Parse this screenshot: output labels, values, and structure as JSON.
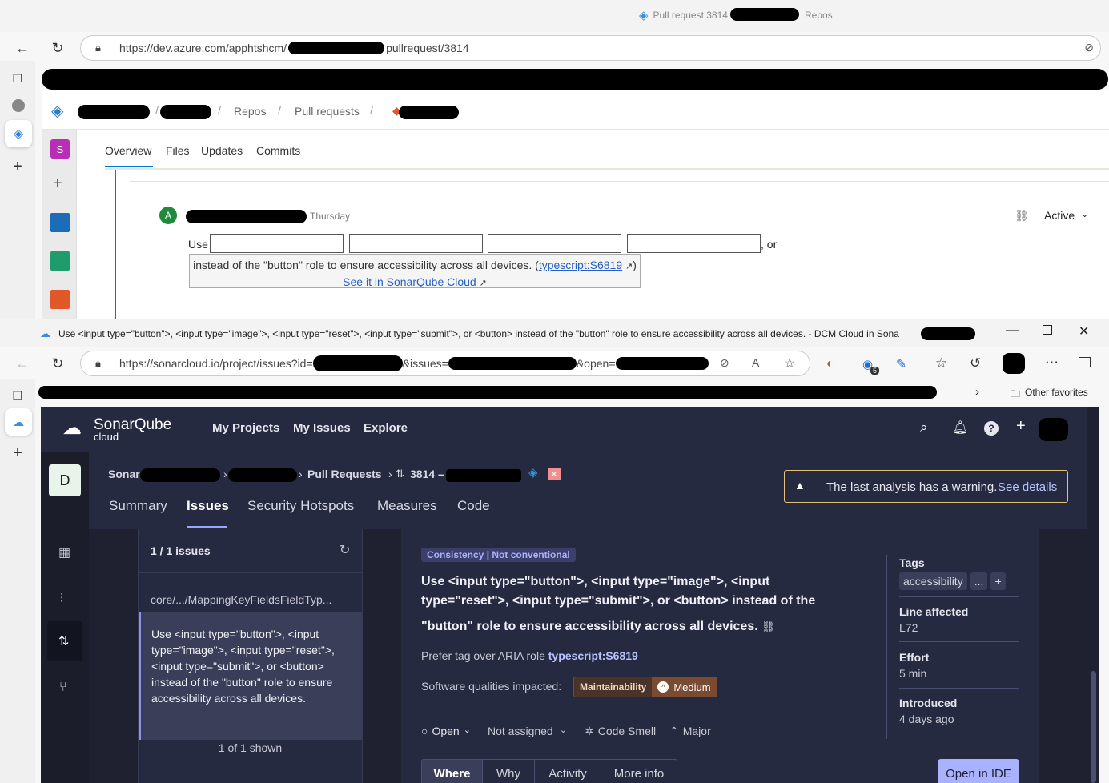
{
  "top_window": {
    "tab_title": "Pull request 3814",
    "tab_suffix": "Repos",
    "url_prefix": "https://dev.azure.com/apphtshcm/",
    "url_suffix": "pullrequest/3814",
    "breadcrumb": {
      "repos": "Repos",
      "pull_requests": "Pull requests",
      "sep": "/"
    },
    "pr_tabs": [
      "Overview",
      "Files",
      "Updates",
      "Commits"
    ],
    "org_letter": "S",
    "comment": {
      "avatar_letter": "A",
      "when": "Thursday",
      "status": "Active",
      "text_use": "Use",
      "text_or": ", or",
      "tooltip_line1": "instead of the \"button\" role to ensure accessibility across all devices. (",
      "tooltip_rule": "typescript:S6819",
      "tooltip_close": ")",
      "tooltip_line2": "See it in SonarQube Cloud"
    }
  },
  "bottom_window": {
    "title": "Use <input type=\"button\">, <input type=\"image\">, <input type=\"reset\">, <input type=\"submit\">, or <button> instead of the \"button\" role to ensure accessibility across all devices. - DCM Cloud in Sona",
    "url_prefix": "https://sonarcloud.io/project/issues?id=",
    "url_mid1": "&issues=",
    "url_mid2": "&open=",
    "other_favorites": "Other favorites",
    "ext_badge": "5"
  },
  "sonar": {
    "logo_main": "SonarQube",
    "logo_sub": "cloud",
    "nav": [
      "My Projects",
      "My Issues",
      "Explore"
    ],
    "project_letter": "D",
    "breadcrumb": {
      "org": "Sonar",
      "pull_requests": "Pull Requests",
      "pr": "3814 –"
    },
    "tabs": [
      "Summary",
      "Issues",
      "Security Hotspots",
      "Measures",
      "Code"
    ],
    "active_tab": "Issues",
    "warning": {
      "text": "The last analysis has a warning.",
      "link": "See details"
    },
    "list": {
      "count": "1 / 1 issues",
      "file": "core/.../MappingKeyFieldsFieldTyp...",
      "issue_text": "Use <input type=\"button\">, <input type=\"image\">, <input type=\"reset\">, <input type=\"submit\">, or <button> instead of the \"button\" role to ensure accessibility across all devices.",
      "shown": "1 of 1 shown"
    },
    "detail": {
      "clean_attr": "Consistency",
      "clean_attr_sub": "Not conventional",
      "title_l1": "Use <input type=\"button\">, <input type=\"image\">, <input",
      "title_l2": "type=\"reset\">, <input type=\"submit\">, or <button> instead of the",
      "title_l3": "\"button\" role to ensure accessibility across all devices.",
      "prefer": "Prefer tag over ARIA role",
      "rule": "typescript:S6819",
      "qualities_label": "Software qualities impacted:",
      "quality": "Maintainability",
      "severity": "Medium",
      "status": "Open",
      "assignee": "Not assigned",
      "type": "Code Smell",
      "impact": "Major",
      "tabs": [
        "Where",
        "Why",
        "Activity",
        "More info"
      ],
      "open_ide": "Open in IDE"
    },
    "meta": {
      "tags_label": "Tags",
      "tag": "accessibility",
      "more": "...",
      "add": "+",
      "line_label": "Line affected",
      "line": "L72",
      "effort_label": "Effort",
      "effort": "5 min",
      "intro_label": "Introduced",
      "intro": "4 days ago"
    }
  }
}
